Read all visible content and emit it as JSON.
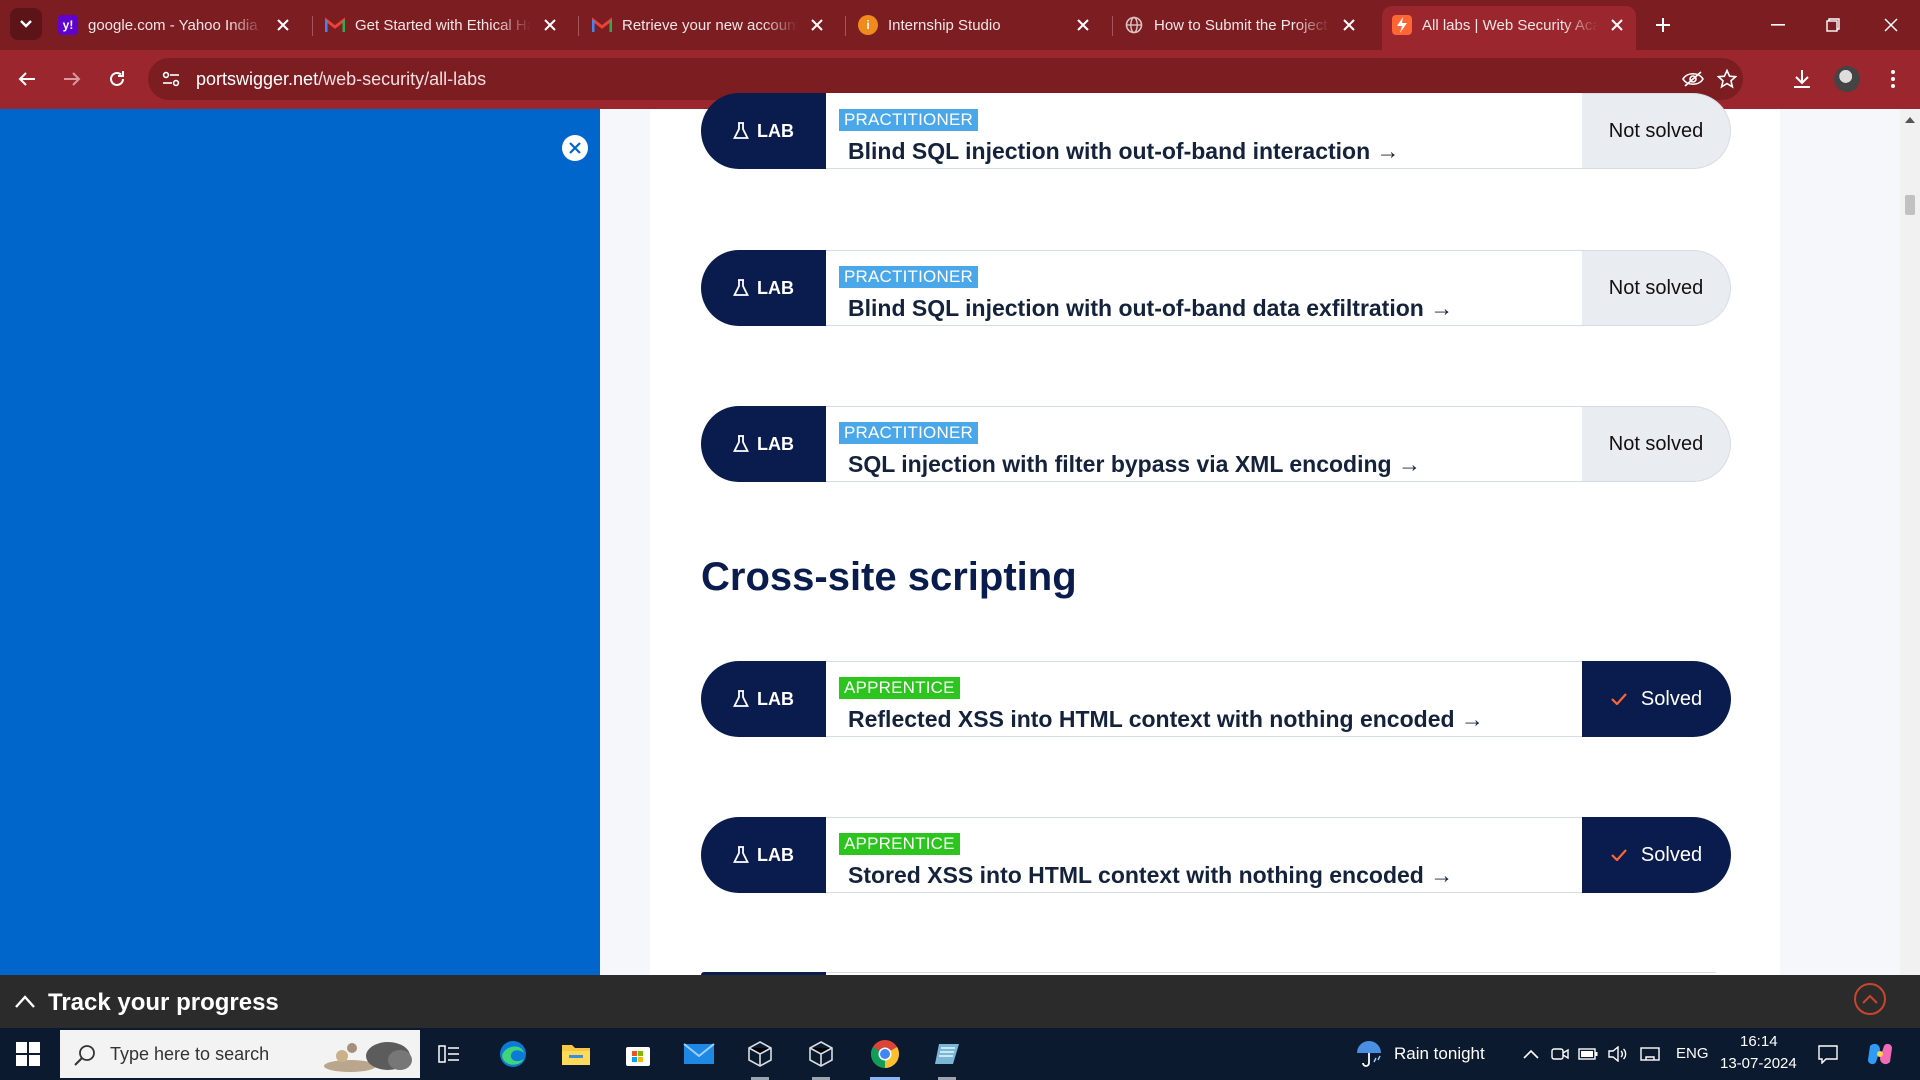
{
  "browser": {
    "tabs": [
      {
        "title": "google.com - Yahoo India",
        "favicon": "yahoo-icon",
        "active": false
      },
      {
        "title": "Get Started with Ethical Hacking",
        "favicon": "gmail-icon",
        "active": false
      },
      {
        "title": "Retrieve your new account",
        "favicon": "gmail-icon",
        "active": false
      },
      {
        "title": "Internship Studio",
        "favicon": "internship-studio-icon",
        "active": false
      },
      {
        "title": "How to Submit the Project",
        "favicon": "globe-icon",
        "active": false
      },
      {
        "title": "All labs | Web Security Academy",
        "favicon": "portswigger-icon",
        "active": true
      }
    ],
    "url_domain": "portswigger.net",
    "url_path": "/web-security/all-labs"
  },
  "page": {
    "sidebar_color": "#0066cc",
    "labs": [
      {
        "badge": "LAB",
        "level": "PRACTITIONER",
        "title": "Blind SQL injection with out-of-band interaction →",
        "status": "Not solved"
      },
      {
        "badge": "LAB",
        "level": "PRACTITIONER",
        "title": "Blind SQL injection with out-of-band data exfiltration →",
        "status": "Not solved"
      },
      {
        "badge": "LAB",
        "level": "PRACTITIONER",
        "title": "SQL injection with filter bypass via XML encoding →",
        "status": "Not solved"
      },
      {
        "badge": "LAB",
        "level": "APPRENTICE",
        "title": "Reflected XSS into HTML context with nothing encoded →",
        "status": "Solved"
      },
      {
        "badge": "LAB",
        "level": "APPRENTICE",
        "title": "Stored XSS into HTML context with nothing encoded →",
        "status": "Solved"
      }
    ],
    "section_heading": "Cross-site scripting",
    "progress_label": "Track your progress"
  },
  "taskbar": {
    "search_placeholder": "Type here to search",
    "weather": "Rain tonight",
    "language": "ENG",
    "time": "16:14",
    "date": "13-07-2024",
    "apps": [
      "task-view-icon",
      "edge-icon",
      "file-explorer-icon",
      "microsoft-store-icon",
      "mail-icon",
      "virtualbox-icon",
      "virtualbox-icon",
      "chrome-icon",
      "notepad-icon"
    ]
  },
  "colors": {
    "navy": "#0a1c4d",
    "practitioner": "#4aa8ea",
    "apprentice": "#2bc51e",
    "chrome_dark": "#7c1d22",
    "chrome": "#9b262d"
  }
}
